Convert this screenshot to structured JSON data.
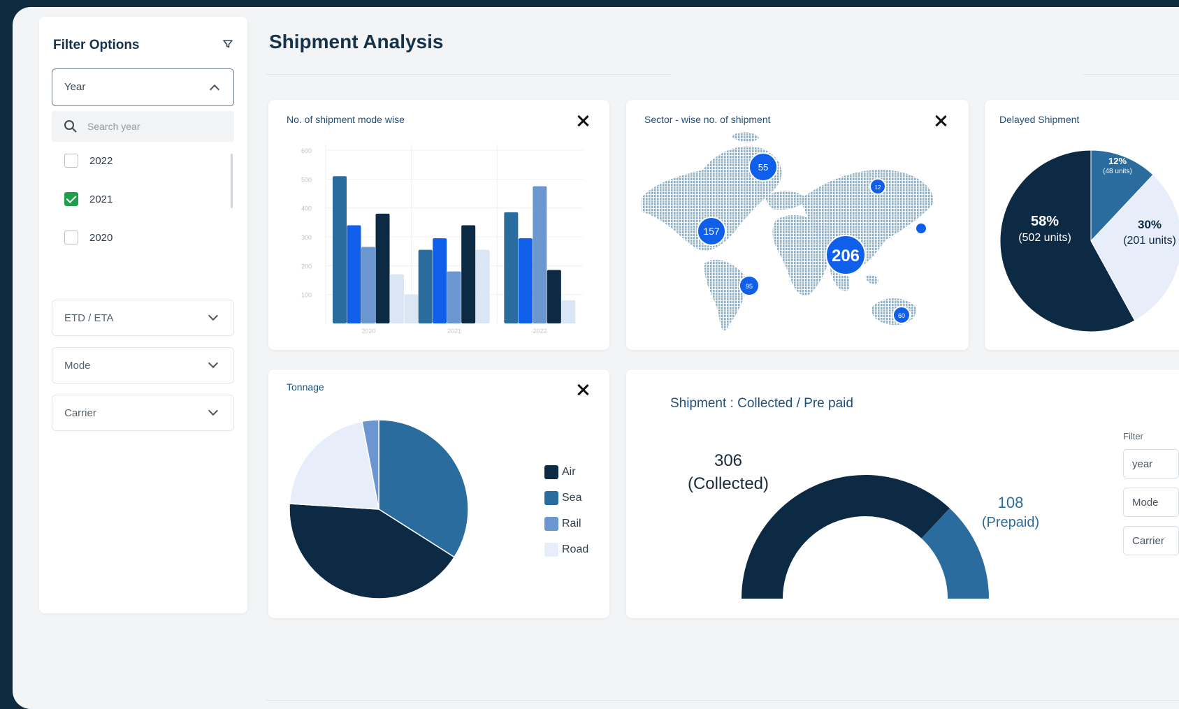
{
  "sidebar": {
    "title": "Filter Options",
    "year_select": {
      "label": "Year"
    },
    "search_placeholder": "Search year",
    "years": [
      {
        "label": "2022",
        "checked": false
      },
      {
        "label": "2021",
        "checked": true
      },
      {
        "label": "2020",
        "checked": false
      }
    ],
    "dropdowns": [
      {
        "label": "ETD / ETA"
      },
      {
        "label": "Mode"
      },
      {
        "label": "Carrier"
      }
    ]
  },
  "main": {
    "title": "Shipment Analysis"
  },
  "cards": {
    "mode_wise": {
      "title": "No. of shipment mode wise"
    },
    "sector_wise": {
      "title": "Sector - wise no. of shipment"
    },
    "delayed": {
      "title": "Delayed Shipment"
    },
    "tonnage": {
      "title": "Tonnage"
    },
    "collected": {
      "title": "Shipment : Collected / Pre paid",
      "filter_label": "Filter",
      "filters": [
        "year",
        "Mode",
        "Carrier"
      ]
    }
  },
  "colors": {
    "air": "#0d2a45",
    "sea": "#2b6c9e",
    "rail": "#6b96cf",
    "road": "#e7eef9",
    "blue": "#0f5fea"
  },
  "chart_data": [
    {
      "type": "bar",
      "title": "No. of shipment mode wise",
      "categories": [
        "2020",
        "2021",
        "2022"
      ],
      "ylim": [
        0,
        600
      ],
      "yticks": [
        "600",
        "500",
        "400",
        "300",
        "200",
        "100"
      ],
      "series": [
        {
          "values": [
            510,
            255,
            385
          ]
        },
        {
          "values": [
            340,
            295,
            295
          ]
        },
        {
          "values": [
            265,
            180,
            475
          ]
        },
        {
          "values": [
            380,
            340,
            185
          ]
        },
        {
          "values": [
            170,
            255,
            80
          ]
        },
        {
          "values": [
            100,
            0,
            0
          ]
        }
      ]
    },
    {
      "type": "pie",
      "title": "Delayed Shipment",
      "slices": [
        {
          "value": 12,
          "label": "12%",
          "sub": "(48 units)"
        },
        {
          "value": 30,
          "label": "30%",
          "sub": "(201 units)"
        },
        {
          "value": 58,
          "label": "58%",
          "sub": "(502 units)"
        }
      ]
    },
    {
      "type": "pie",
      "title": "Tonnage",
      "slices": [
        {
          "name": "Air",
          "value": 42
        },
        {
          "name": "Sea",
          "value": 34
        },
        {
          "name": "Rail",
          "value": 3
        },
        {
          "name": "Road",
          "value": 21
        }
      ]
    },
    {
      "type": "pie",
      "title": "Shipment : Collected / Pre paid",
      "slices": [
        {
          "value": 306,
          "label": "306",
          "sub": "(Collected)"
        },
        {
          "value": 108,
          "label": "108",
          "sub": "(Prepaid)"
        }
      ]
    }
  ],
  "map": {
    "bubbles": [
      "55",
      "157",
      "206",
      "95",
      "12",
      "60"
    ]
  }
}
